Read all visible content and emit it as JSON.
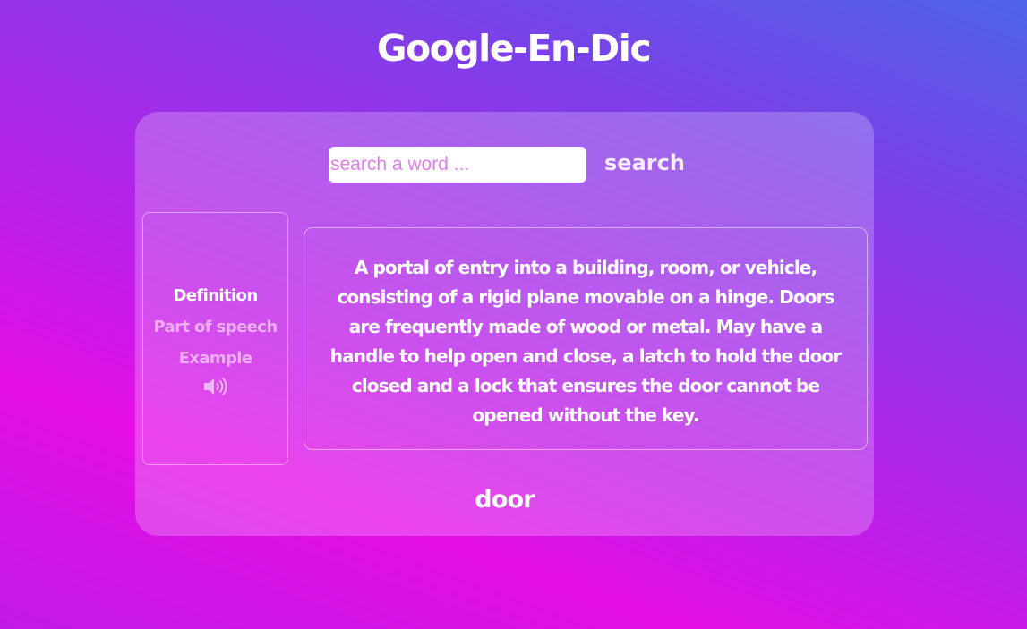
{
  "app": {
    "title": "Google-En-Dic"
  },
  "search": {
    "placeholder": "search a word ...",
    "value": "",
    "button_label": "search"
  },
  "nav": {
    "items": [
      {
        "label": "Definition",
        "active": true
      },
      {
        "label": "Part of speech",
        "active": false
      },
      {
        "label": "Example",
        "active": false
      }
    ],
    "audio_icon": "speaker-volume-icon"
  },
  "result": {
    "definition": "A portal of entry into a building, room, or vehicle, consisting of a rigid plane movable on a hinge. Doors are frequently made of wood or metal. May have a handle to help open and close, a latch to hold the door closed and a lock that ensures the door cannot be opened without the key.",
    "word": "door"
  },
  "colors": {
    "gradient_top_right": "#4d63ea",
    "gradient_bottom": "#e40fe6",
    "placeholder_text": "#e07ee8",
    "text": "#ffffff"
  }
}
